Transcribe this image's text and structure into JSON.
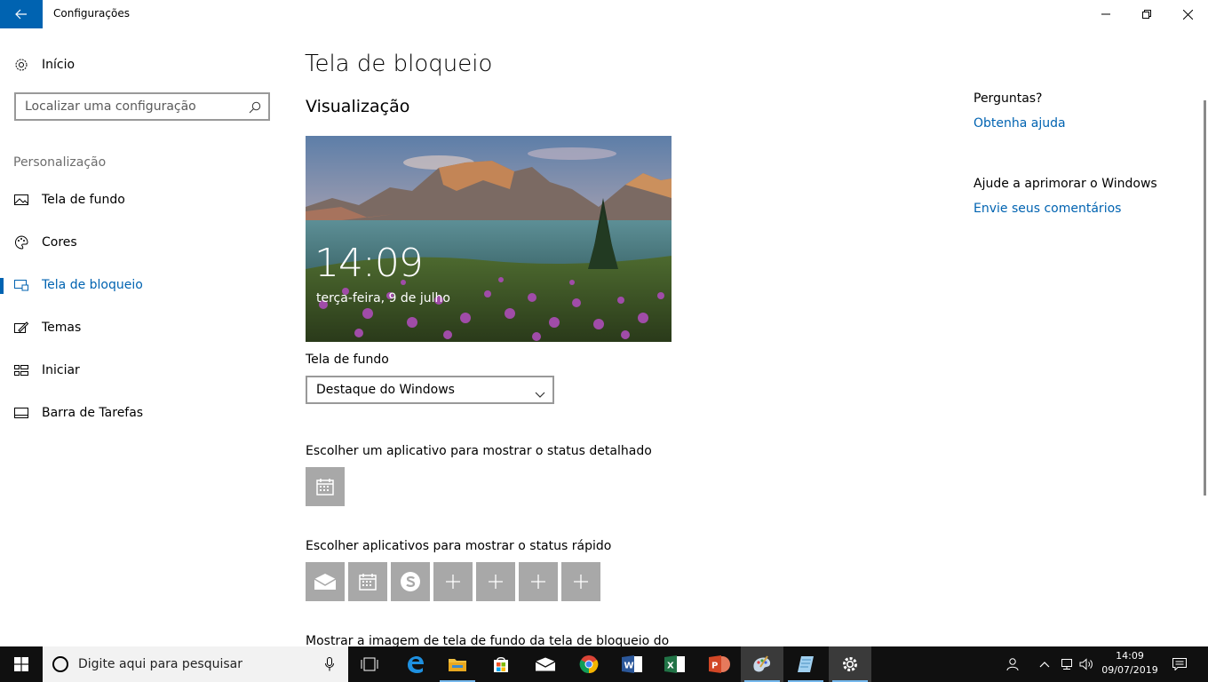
{
  "window": {
    "title": "Configurações"
  },
  "sidebar": {
    "home_label": "Início",
    "search_placeholder": "Localizar uma configuração",
    "section_header": "Personalização",
    "items": [
      {
        "label": "Tela de fundo",
        "icon": "picture-icon"
      },
      {
        "label": "Cores",
        "icon": "palette-icon"
      },
      {
        "label": "Tela de bloqueio",
        "icon": "lock-screen-icon",
        "selected": true
      },
      {
        "label": "Temas",
        "icon": "themes-icon"
      },
      {
        "label": "Iniciar",
        "icon": "start-layout-icon"
      },
      {
        "label": "Barra de Tarefas",
        "icon": "taskbar-icon"
      }
    ]
  },
  "main": {
    "title": "Tela de bloqueio",
    "preview_header": "Visualização",
    "preview_time": "14:09",
    "preview_date": "terça-feira, 9 de julho",
    "background_label": "Tela de fundo",
    "background_value": "Destaque do Windows",
    "detailed_status_label": "Escolher um aplicativo para mostrar o status detalhado",
    "quick_status_label": "Escolher aplicativos para mostrar o status rápido",
    "quick_status_apps": [
      "mail-icon",
      "calendar-icon",
      "skype-icon",
      "add-icon",
      "add-icon",
      "add-icon",
      "add-icon"
    ],
    "partial_text": "Mostrar a imagem de tela de fundo da tela de bloqueio do"
  },
  "right_panel": {
    "questions_header": "Perguntas?",
    "help_link": "Obtenha ajuda",
    "improve_header": "Ajude a aprimorar o Windows",
    "feedback_link": "Envie seus comentários"
  },
  "taskbar": {
    "search_placeholder": "Digite aqui para pesquisar",
    "time": "14:09",
    "date": "09/07/2019"
  },
  "colors": {
    "accent": "#0063b1",
    "tile_gray": "#a8a8a8",
    "taskbar_bg": "#101010"
  }
}
